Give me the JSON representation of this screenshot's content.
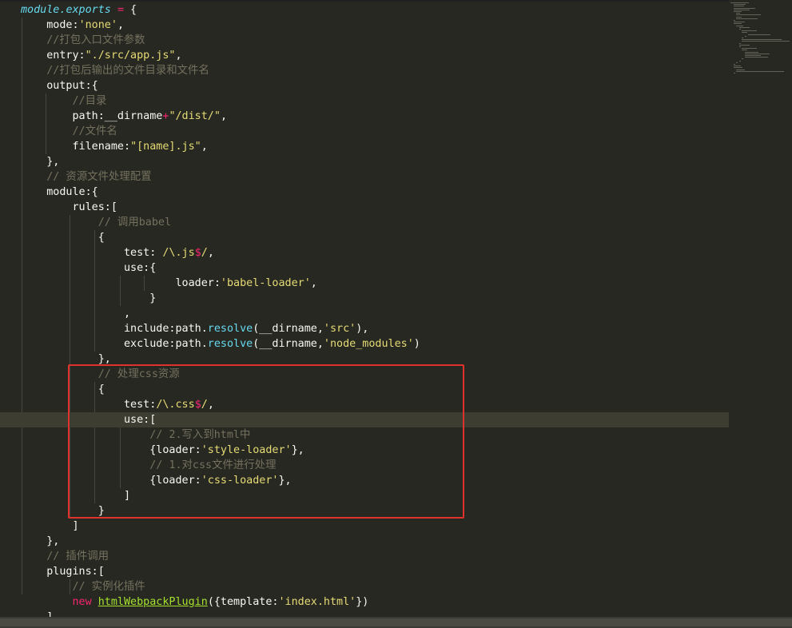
{
  "editor": {
    "theme_colors": {
      "background": "#272822",
      "highlight_line": "#3e3d32",
      "keyword": "#66d9ef",
      "string": "#e6db74",
      "comment": "#75715e",
      "operator": "#f92672",
      "class": "#a6e22e",
      "annotation_box": "#e0322d"
    },
    "highlighted_line": 27,
    "lines": [
      [
        [
          "kw",
          "module"
        ],
        [
          "kw",
          "."
        ],
        [
          "kw",
          "exports"
        ],
        [
          "pun",
          " "
        ],
        [
          "op",
          "="
        ],
        [
          "pun",
          " {"
        ]
      ],
      [
        [
          "pun",
          "    mode:"
        ],
        [
          "str",
          "'none'"
        ],
        [
          "pun",
          ","
        ]
      ],
      [
        [
          "com",
          "    //打包入口文件参数"
        ]
      ],
      [
        [
          "pun",
          "    entry:"
        ],
        [
          "str",
          "\"./src/app.js\""
        ],
        [
          "pun",
          ","
        ]
      ],
      [
        [
          "com",
          "    //打包后输出的文件目录和文件名"
        ]
      ],
      [
        [
          "pun",
          "    output:{"
        ]
      ],
      [
        [
          "com",
          "        //目录"
        ]
      ],
      [
        [
          "pun",
          "        path:__dirname"
        ],
        [
          "op",
          "+"
        ],
        [
          "str",
          "\"/dist/\""
        ],
        [
          "pun",
          ","
        ]
      ],
      [
        [
          "com",
          "        //文件名"
        ]
      ],
      [
        [
          "pun",
          "        filename:"
        ],
        [
          "str",
          "\"[name].js\""
        ],
        [
          "pun",
          ","
        ]
      ],
      [
        [
          "pun",
          "    },"
        ]
      ],
      [
        [
          "com",
          "    // 资源文件处理配置"
        ]
      ],
      [
        [
          "pun",
          "    module:{"
        ]
      ],
      [
        [
          "pun",
          "        rules:["
        ]
      ],
      [
        [
          "com",
          "            // 调用babel"
        ]
      ],
      [
        [
          "pun",
          "            {"
        ]
      ],
      [
        [
          "pun",
          "                test: "
        ],
        [
          "re",
          "/\\.js"
        ],
        [
          "op",
          "$"
        ],
        [
          "re",
          "/"
        ],
        [
          "pun",
          ","
        ]
      ],
      [
        [
          "pun",
          "                use:{"
        ]
      ],
      [
        [
          "pun",
          "                        loader:"
        ],
        [
          "str",
          "'babel-loader'"
        ],
        [
          "pun",
          ","
        ]
      ],
      [
        [
          "pun",
          "                    }"
        ]
      ],
      [
        [
          "pun",
          "                ,"
        ]
      ],
      [
        [
          "pun",
          "                include:path."
        ],
        [
          "fn",
          "resolve"
        ],
        [
          "pun",
          "(__dirname,"
        ],
        [
          "str",
          "'src'"
        ],
        [
          "pun",
          "),"
        ]
      ],
      [
        [
          "pun",
          "                exclude:path."
        ],
        [
          "fn",
          "resolve"
        ],
        [
          "pun",
          "(__dirname,"
        ],
        [
          "str",
          "'node_modules'"
        ],
        [
          "pun",
          ")"
        ]
      ],
      [
        [
          "pun",
          "            },"
        ]
      ],
      [
        [
          "com",
          "            // 处理css资源"
        ]
      ],
      [
        [
          "pun",
          "            {"
        ]
      ],
      [
        [
          "pun",
          "                test:"
        ],
        [
          "re",
          "/\\.css"
        ],
        [
          "op",
          "$"
        ],
        [
          "re",
          "/"
        ],
        [
          "pun",
          ","
        ]
      ],
      [
        [
          "pun",
          "                use:["
        ]
      ],
      [
        [
          "com",
          "                    // 2.写入到html中"
        ]
      ],
      [
        [
          "pun",
          "                    {loader:"
        ],
        [
          "str",
          "'style-loader'"
        ],
        [
          "pun",
          "},"
        ]
      ],
      [
        [
          "com",
          "                    // 1.对css文件进行处理"
        ]
      ],
      [
        [
          "pun",
          "                    {loader:"
        ],
        [
          "str",
          "'css-loader'"
        ],
        [
          "pun",
          "},"
        ]
      ],
      [
        [
          "pun",
          "                ]"
        ]
      ],
      [
        [
          "pun",
          "            }"
        ]
      ],
      [
        [
          "pun",
          "        ]"
        ]
      ],
      [
        [
          "pun",
          "    },"
        ]
      ],
      [
        [
          "com",
          "    // 插件调用"
        ]
      ],
      [
        [
          "pun",
          "    plugins:["
        ]
      ],
      [
        [
          "com",
          "        // 实例化插件"
        ]
      ],
      [
        [
          "new",
          "        new "
        ],
        [
          "cls",
          "htmlWebpackPlugin"
        ],
        [
          "pun",
          "({template:"
        ],
        [
          "str",
          "'index.html'"
        ],
        [
          "pun",
          "})"
        ]
      ],
      [
        [
          "pun",
          "    ]"
        ]
      ]
    ]
  }
}
